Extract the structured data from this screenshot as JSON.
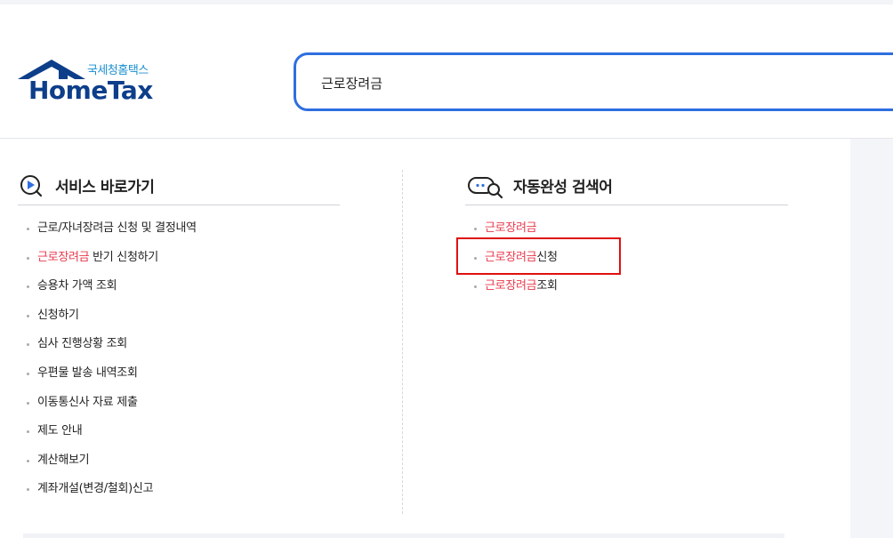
{
  "logo": {
    "sub": "국세청홈택스",
    "main": "HomeTax"
  },
  "search": {
    "value": "근로장려금"
  },
  "services": {
    "title": "서비스 바로가기",
    "icon": "play-circle-icon",
    "items": [
      {
        "hl": "",
        "rest": "근로/자녀장려금 신청 및 결정내역"
      },
      {
        "hl": "근로장려금",
        "rest": " 반기 신청하기"
      },
      {
        "hl": "",
        "rest": "승용차 가액 조회"
      },
      {
        "hl": "",
        "rest": "신청하기"
      },
      {
        "hl": "",
        "rest": "심사 진행상황 조회"
      },
      {
        "hl": "",
        "rest": "우편물 발송 내역조회"
      },
      {
        "hl": "",
        "rest": "이동통신사 자료 제출"
      },
      {
        "hl": "",
        "rest": "제도 안내"
      },
      {
        "hl": "",
        "rest": "계산해보기"
      },
      {
        "hl": "",
        "rest": "계좌개설(변경/철회)신고"
      }
    ]
  },
  "autocomplete": {
    "title": "자동완성 검색어",
    "icon": "search-chat-icon",
    "items": [
      {
        "hl": "근로장려금",
        "rest": ""
      },
      {
        "hl": "근로장려금",
        "rest": "신청"
      },
      {
        "hl": "근로장려금",
        "rest": "조회"
      }
    ]
  },
  "colors": {
    "accent": "#2e6fe0",
    "highlight": "#e8394d",
    "annotation": "#e01010",
    "brand": "#0d3e8a"
  }
}
